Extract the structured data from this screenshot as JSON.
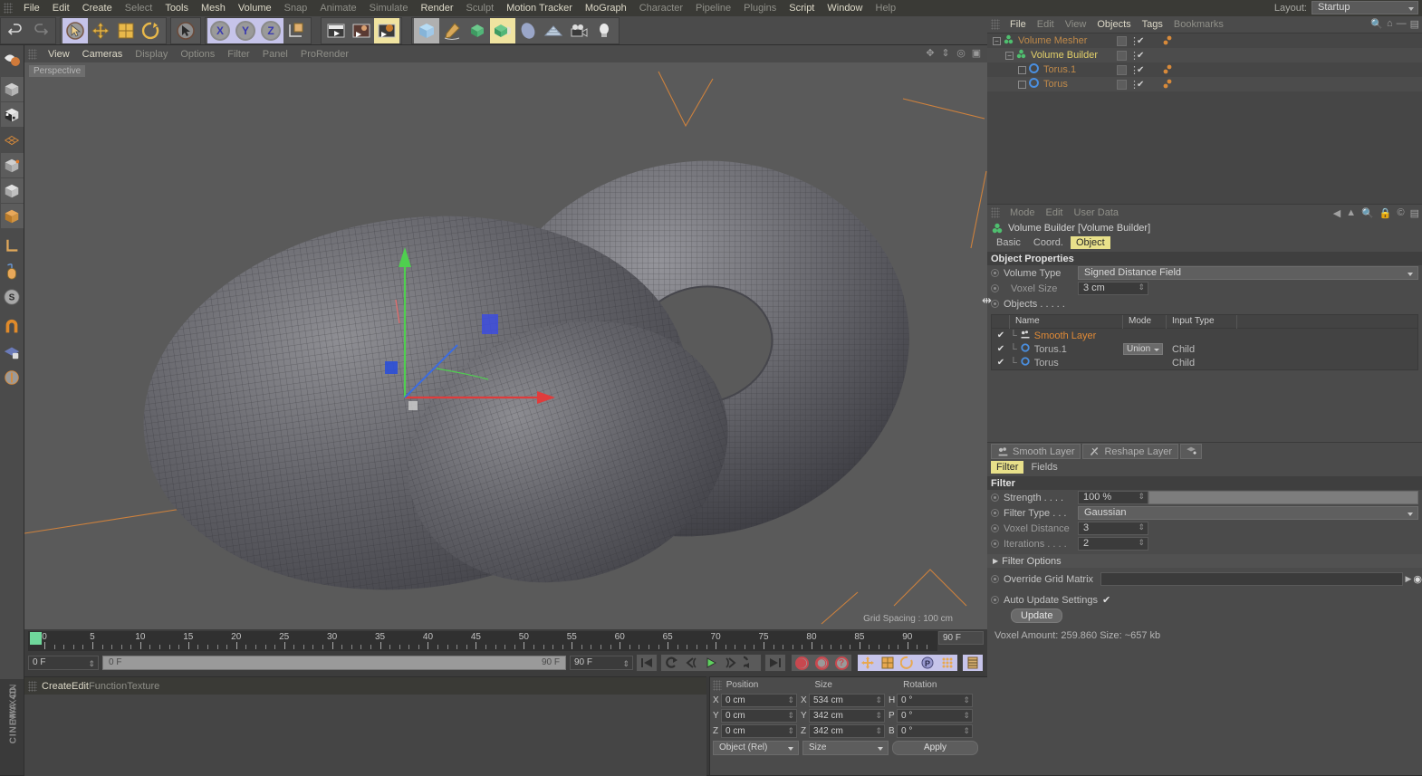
{
  "app": {
    "name": "MAXON",
    "product": "CINEMA 4D"
  },
  "menubar": {
    "items": [
      {
        "label": "File",
        "bright": true
      },
      {
        "label": "Edit",
        "bright": true
      },
      {
        "label": "Create",
        "bright": true
      },
      {
        "label": "Select",
        "bright": false
      },
      {
        "label": "Tools",
        "bright": true
      },
      {
        "label": "Mesh",
        "bright": true
      },
      {
        "label": "Volume",
        "bright": true
      },
      {
        "label": "Snap",
        "bright": false
      },
      {
        "label": "Animate",
        "bright": false
      },
      {
        "label": "Simulate",
        "bright": false
      },
      {
        "label": "Render",
        "bright": true
      },
      {
        "label": "Sculpt",
        "bright": false
      },
      {
        "label": "Motion Tracker",
        "bright": true
      },
      {
        "label": "MoGraph",
        "bright": true
      },
      {
        "label": "Character",
        "bright": false
      },
      {
        "label": "Pipeline",
        "bright": false
      },
      {
        "label": "Plugins",
        "bright": false
      },
      {
        "label": "Script",
        "bright": true
      },
      {
        "label": "Window",
        "bright": true
      },
      {
        "label": "Help",
        "bright": false
      }
    ],
    "layout_label": "Layout:",
    "layout_value": "Startup"
  },
  "toolbar": {
    "undo": "undo-icon",
    "redo": "redo-icon",
    "tools": [
      "live-selection-icon",
      "move-icon",
      "scale-icon",
      "rotate-icon"
    ],
    "select2": "selection-icon",
    "axes": [
      "X",
      "Y",
      "Z"
    ],
    "coordsys": "world-object-axis-icon",
    "render_tools": [
      "render-view-icon",
      "render-region-icon",
      "render-settings-icon"
    ],
    "primitives": [
      "cube-icon",
      "spline-pen-icon",
      "nurbs-icon",
      "array-icon",
      "deformer-icon",
      "floor-icon",
      "camera-icon",
      "light-icon"
    ]
  },
  "lefttoolbar": {
    "items": [
      "sculpt-brush-icon",
      "model-mode-icon",
      "texture-mode-icon",
      "points-mode-icon",
      "edges-mode-icon",
      "polygons-mode-icon",
      "object-axis-icon",
      "workplane-icon",
      "enable-axis-icon",
      "lock-axis-icon",
      "snap-icon",
      "quantize-icon",
      "lock-workplane-icon",
      "planar-workplane-icon"
    ]
  },
  "viewport": {
    "menu": [
      {
        "label": "View",
        "bright": true
      },
      {
        "label": "Cameras",
        "bright": true
      },
      {
        "label": "Display",
        "bright": false
      },
      {
        "label": "Options",
        "bright": false
      },
      {
        "label": "Filter",
        "bright": false
      },
      {
        "label": "Panel",
        "bright": false
      },
      {
        "label": "ProRender",
        "bright": false
      }
    ],
    "view_label": "Perspective",
    "grid_spacing": "Grid Spacing : 100 cm",
    "icons": [
      "pan-icon",
      "dolly-icon",
      "orbit-icon",
      "maximize-icon"
    ]
  },
  "timeline": {
    "start_frame": "0 F",
    "end_frame": "90 F",
    "current_frame_left": "0 F",
    "scrub_left_label": "0 F",
    "scrub_right_label": "90 F",
    "preview_end": "90 F",
    "ticks": [
      0,
      5,
      10,
      15,
      20,
      25,
      30,
      35,
      40,
      45,
      50,
      55,
      60,
      65,
      70,
      75,
      80,
      85,
      90
    ],
    "transport": [
      "go-to-start-icon",
      "play-reverse-loop-icon",
      "step-back-icon",
      "play-icon",
      "step-forward-icon",
      "loop-icon",
      "go-to-end-icon"
    ],
    "record": [
      "record-icon",
      "autokey-icon",
      "keyframe-help-icon"
    ],
    "keyflags": [
      "position-key-icon",
      "scale-key-icon",
      "rotation-key-icon",
      "param-key-icon",
      "pla-key-icon",
      "timeline-icon"
    ]
  },
  "materialbar": {
    "menu": [
      {
        "label": "Create",
        "bright": true
      },
      {
        "label": "Edit",
        "bright": true
      },
      {
        "label": "Function",
        "bright": false
      },
      {
        "label": "Texture",
        "bright": false
      }
    ]
  },
  "coordinates": {
    "headers": [
      "Position",
      "Size",
      "Rotation"
    ],
    "rows": [
      {
        "a1": "X",
        "v1": "0 cm",
        "a2": "X",
        "v2": "534 cm",
        "a3": "H",
        "v3": "0 °"
      },
      {
        "a1": "Y",
        "v1": "0 cm",
        "a2": "Y",
        "v2": "342 cm",
        "a3": "P",
        "v3": "0 °"
      },
      {
        "a1": "Z",
        "v1": "0 cm",
        "a2": "Z",
        "v2": "342 cm",
        "a3": "B",
        "v3": "0 °"
      }
    ],
    "dd_left": "Object (Rel)",
    "dd_mid": "Size",
    "apply": "Apply"
  },
  "object_manager": {
    "menu": [
      {
        "label": "File",
        "bright": true
      },
      {
        "label": "Edit",
        "bright": false
      },
      {
        "label": "View",
        "bright": false
      },
      {
        "label": "Objects",
        "bright": true
      },
      {
        "label": "Tags",
        "bright": true
      },
      {
        "label": "Bookmarks",
        "bright": false
      }
    ],
    "icons": [
      "search-icon",
      "home-icon",
      "minus-icon",
      "layer-icon"
    ],
    "tree": [
      {
        "label": "Volume Mesher",
        "depth": 0,
        "color": "#c08a4a",
        "icon": "volume-mesher-icon",
        "has_tag": true
      },
      {
        "label": "Volume Builder",
        "depth": 1,
        "color": "#e3d06a",
        "icon": "volume-builder-icon",
        "has_tag": false
      },
      {
        "label": "Torus.1",
        "depth": 2,
        "color": "#c08a4a",
        "icon": "torus-icon",
        "has_tag": true
      },
      {
        "label": "Torus",
        "depth": 2,
        "color": "#c08a4a",
        "icon": "torus-icon",
        "has_tag": true
      }
    ]
  },
  "attribute_manager": {
    "menu": [
      {
        "label": "Mode",
        "bright": false
      },
      {
        "label": "Edit",
        "bright": false
      },
      {
        "label": "User Data",
        "bright": false
      }
    ],
    "icons": [
      "back-arrow-icon",
      "forward-arrow-icon",
      "search-icon",
      "lock-icon",
      "copyright-icon",
      "list-icon"
    ],
    "title": "Volume Builder [Volume Builder]",
    "tabs": [
      {
        "label": "Basic",
        "active": false
      },
      {
        "label": "Coord.",
        "active": false
      },
      {
        "label": "Object",
        "active": true
      }
    ],
    "section_title": "Object Properties",
    "volume_type_label": "Volume Type",
    "volume_type_value": "Signed Distance Field",
    "voxel_size_label": "Voxel Size",
    "voxel_size_value": "3 cm",
    "objects_label": "Objects . . . . .",
    "object_list": {
      "headers": [
        "Name",
        "Mode",
        "Input Type"
      ],
      "rows": [
        {
          "checked": "✔",
          "name": "Smooth Layer",
          "icon": "smooth-layer-icon",
          "color": "#e08a36",
          "mode": "",
          "input": ""
        },
        {
          "checked": "✔",
          "name": "Torus.1",
          "icon": "torus-icon",
          "color": "#b6b6b6",
          "mode": "Union",
          "input": "Child"
        },
        {
          "checked": "✔",
          "name": "Torus",
          "icon": "torus-icon",
          "color": "#b6b6b6",
          "mode": "",
          "input": "Child"
        }
      ]
    }
  },
  "layer_panel": {
    "smooth_layer": "Smooth Layer",
    "reshape_layer": "Reshape Layer",
    "add_layer_icon": "add-layer-icon",
    "tabs": [
      {
        "label": "Filter",
        "active": true
      },
      {
        "label": "Fields",
        "active": false
      }
    ],
    "section_title": "Filter",
    "strength_label": "Strength . . . .",
    "strength_value": "100 %",
    "filter_type_label": "Filter Type . . .",
    "filter_type_value": "Gaussian",
    "voxel_distance_label": "Voxel Distance",
    "voxel_distance_value": "3",
    "iterations_label": "Iterations . . . .",
    "iterations_value": "2",
    "filter_options_label": "Filter Options",
    "override_grid_label": "Override Grid Matrix",
    "auto_update_label": "Auto Update Settings",
    "auto_update_checked": "✔",
    "update_button": "Update",
    "voxel_info": "Voxel Amount: 259.860   Size: ~657 kb"
  },
  "colors": {
    "accent_yellow": "#e8e08a",
    "orange_text": "#c08a4a",
    "panel_bg": "#4b4b4b",
    "viewport_bg": "#5a5a5a"
  }
}
